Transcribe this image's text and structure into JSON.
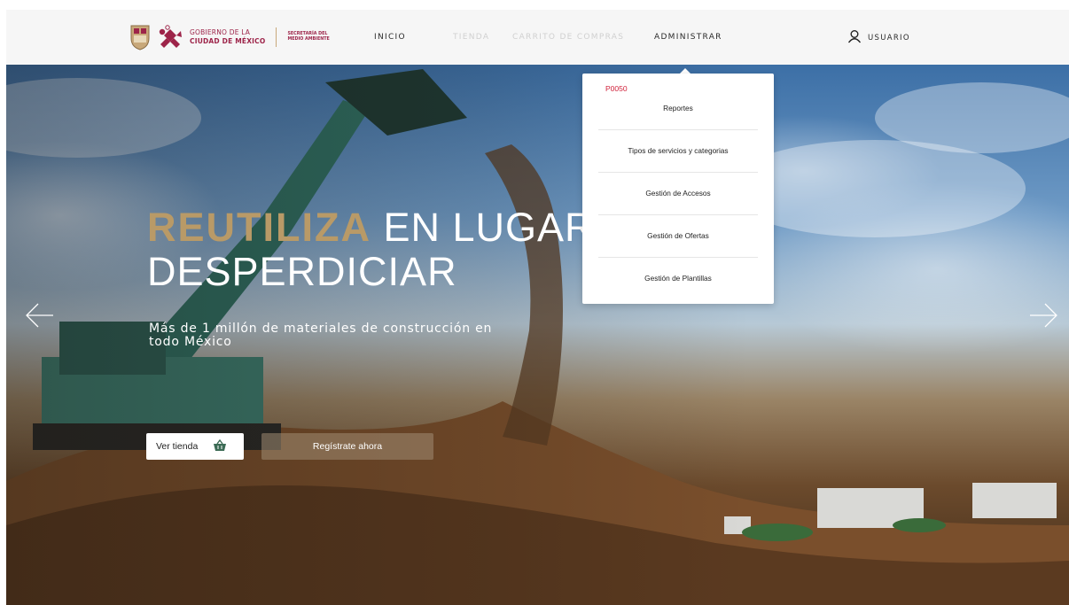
{
  "header": {
    "brand_line1": "GOBIERNO DE LA",
    "brand_line2": "CIUDAD DE MÉXICO",
    "secretaria": "SECRETARÍA DEL MEDIO AMBIENTE",
    "nav": {
      "inicio": "INICIO",
      "tienda": "TIENDA",
      "carrito": "CARRITO DE COMPRAS",
      "administrar": "ADMINISTRAR"
    },
    "user_label": "USUARIO"
  },
  "dropdown": {
    "code": "P0050",
    "items": [
      "Reportes",
      "Tipos de servicios y categorias",
      "Gestión de Accesos",
      "Gestión de Ofertas",
      "Gestión de Plantillas"
    ]
  },
  "hero": {
    "headline_accent": "REUTILIZA",
    "headline_rest": " EN LUGAR DE",
    "headline_line2": "DESPERDICIAR",
    "subline": "Más de 1 millón de materiales de construcción en todo México",
    "btn_store": "Ver tienda",
    "btn_register": "Regístrate ahora"
  },
  "icons": {
    "user": "user-icon",
    "basket": "basket-icon",
    "prev": "arrow-left-icon",
    "next": "arrow-right-icon"
  },
  "colors": {
    "brand": "#9d2449",
    "gold": "#b99a67",
    "code_red": "#d0213a"
  }
}
